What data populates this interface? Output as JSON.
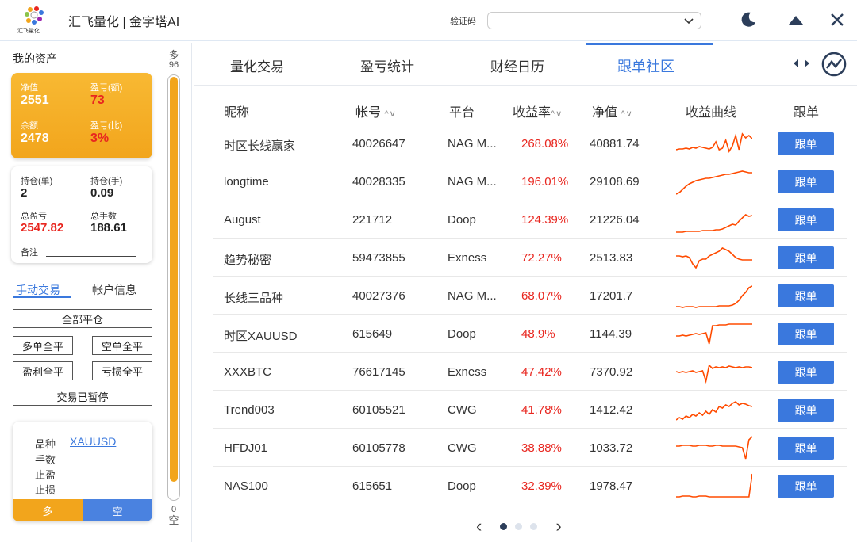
{
  "titlebar": {
    "logo_text": "汇飞量化",
    "title": "汇飞量化 | 金字塔AI",
    "captcha_label": "验证码",
    "captcha_value": ""
  },
  "assets": {
    "section_title": "我的资产",
    "net_value_label": "净值",
    "net_value": "2551",
    "pnl_amount_label": "盈亏(额)",
    "pnl_amount": "73",
    "balance_label": "余额",
    "balance": "2478",
    "pnl_ratio_label": "盈亏(比)",
    "pnl_ratio": "3%",
    "positions_label": "持仓(单)",
    "positions": "2",
    "lots_label": "持仓(手)",
    "lots": "0.09",
    "total_pnl_label": "总盈亏",
    "total_pnl": "2547.82",
    "total_lots_label": "总手数",
    "total_lots": "188.61",
    "remark_label": "备注"
  },
  "trade": {
    "tab_manual": "手动交易",
    "tab_account": "帐户信息",
    "close_all": "全部平仓",
    "close_long": "多单全平",
    "close_short": "空单全平",
    "close_profit": "盈利全平",
    "close_loss": "亏损全平",
    "trading_paused": "交易已暂停",
    "symbol_label": "品种",
    "symbol": "XAUUSD",
    "lots_label": "手数",
    "take_profit_label": "止盈",
    "stop_loss_label": "止损",
    "buy": "多",
    "sell": "空"
  },
  "gauge": {
    "top_label": "多",
    "top_value": "96",
    "bottom_value": "0",
    "bottom_label": "空",
    "long_fraction": 0.96
  },
  "tabs": [
    "量化交易",
    "盈亏统计",
    "财经日历",
    "跟单社区"
  ],
  "active_tab": 3,
  "table": {
    "headers": [
      "昵称",
      "帐号",
      "平台",
      "收益率",
      "净值",
      "收益曲线",
      "跟单"
    ],
    "sort_glyph": "^∨",
    "follow_label": "跟单",
    "rows": [
      {
        "name": "时区长线赢家",
        "account": "40026647",
        "platform": "NAG M...",
        "yield": "268.08%",
        "equity": "40881.74",
        "curve": [
          10,
          11,
          11,
          12,
          11,
          13,
          12,
          14,
          13,
          12,
          11,
          13,
          20,
          10,
          12,
          22,
          8,
          15,
          28,
          10,
          30,
          25,
          28,
          24
        ]
      },
      {
        "name": "longtime",
        "account": "40028335",
        "platform": "NAG M...",
        "yield": "196.01%",
        "equity": "29108.69",
        "curve": [
          2,
          4,
          8,
          12,
          15,
          17,
          19,
          20,
          21,
          22,
          22,
          23,
          24,
          25,
          26,
          27,
          27,
          28,
          29,
          30,
          31,
          30,
          29,
          29
        ]
      },
      {
        "name": "August",
        "account": "221712",
        "platform": "Doop",
        "yield": "124.39%",
        "equity": "21226.04",
        "curve": [
          2,
          2,
          2,
          3,
          3,
          3,
          3,
          3,
          4,
          4,
          4,
          4,
          5,
          5,
          6,
          8,
          10,
          12,
          11,
          16,
          20,
          24,
          22,
          23
        ]
      },
      {
        "name": "趋势秘密",
        "account": "59473855",
        "platform": "Exness",
        "yield": "72.27%",
        "equity": "2513.83",
        "curve": [
          20,
          20,
          19,
          20,
          18,
          10,
          5,
          14,
          16,
          16,
          20,
          22,
          24,
          26,
          30,
          28,
          26,
          22,
          18,
          16,
          15,
          15,
          15,
          15
        ]
      },
      {
        "name": "长线三品种",
        "account": "40027376",
        "platform": "NAG M...",
        "yield": "68.07%",
        "equity": "17201.7",
        "curve": [
          4,
          4,
          3,
          4,
          4,
          4,
          3,
          4,
          4,
          4,
          4,
          4,
          4,
          5,
          5,
          5,
          5,
          6,
          8,
          12,
          18,
          22,
          28,
          30
        ]
      },
      {
        "name": "时区XAUUSD",
        "account": "615649",
        "platform": "Doop",
        "yield": "48.9%",
        "equity": "1144.39",
        "curve": [
          15,
          15,
          16,
          15,
          16,
          17,
          18,
          17,
          18,
          19,
          5,
          28,
          28,
          29,
          29,
          29,
          30,
          30,
          30,
          30,
          30,
          30,
          30,
          30
        ]
      },
      {
        "name": "XXXBTC",
        "account": "76617145",
        "platform": "Exness",
        "yield": "47.42%",
        "equity": "7370.92",
        "curve": [
          18,
          17,
          18,
          17,
          18,
          19,
          17,
          18,
          19,
          6,
          26,
          22,
          24,
          23,
          24,
          23,
          25,
          24,
          23,
          24,
          23,
          24,
          24,
          23
        ]
      },
      {
        "name": "Trend003",
        "account": "60105521",
        "platform": "CWG",
        "yield": "41.78%",
        "equity": "1412.42",
        "curve": [
          5,
          8,
          6,
          10,
          8,
          12,
          10,
          14,
          11,
          16,
          12,
          18,
          15,
          22,
          20,
          24,
          22,
          26,
          28,
          24,
          26,
          25,
          23,
          22
        ]
      },
      {
        "name": "HFDJ01",
        "account": "60105778",
        "platform": "CWG",
        "yield": "38.88%",
        "equity": "1033.72",
        "curve": [
          20,
          20,
          21,
          21,
          21,
          20,
          20,
          21,
          21,
          21,
          20,
          20,
          21,
          21,
          20,
          20,
          20,
          20,
          20,
          19,
          18,
          4,
          28,
          32
        ]
      },
      {
        "name": "NAS100",
        "account": "615651",
        "platform": "Doop",
        "yield": "32.39%",
        "equity": "1978.47",
        "curve": [
          4,
          4,
          5,
          5,
          5,
          4,
          4,
          5,
          5,
          5,
          4,
          4,
          4,
          4,
          4,
          4,
          4,
          4,
          4,
          4,
          4,
          4,
          4,
          33
        ]
      }
    ]
  },
  "pager": {
    "prev": "‹",
    "next": "›",
    "pages": 3,
    "current": 0
  },
  "colors": {
    "accent": "#3a78dd",
    "orange": "#f2a51c",
    "red": "#e8261f",
    "curve": "#ff4b00"
  }
}
